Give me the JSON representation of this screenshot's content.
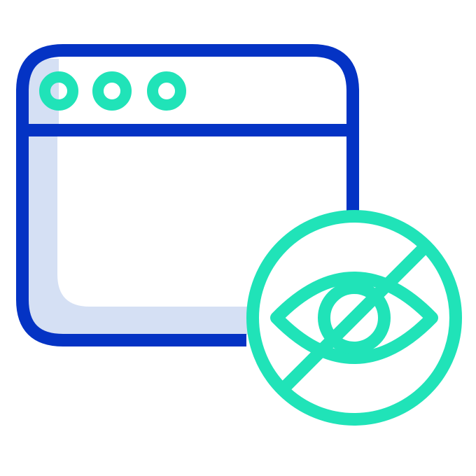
{
  "icon": {
    "name": "hidden-browser-window-icon",
    "colors": {
      "frame": "#0433c4",
      "shade": "#d5e0f4",
      "accent": "#20e3b8",
      "background": "#ffffff"
    },
    "window_dots": [
      "window-dot-1",
      "window-dot-2",
      "window-dot-3"
    ],
    "badge": "eye-slash-icon"
  }
}
